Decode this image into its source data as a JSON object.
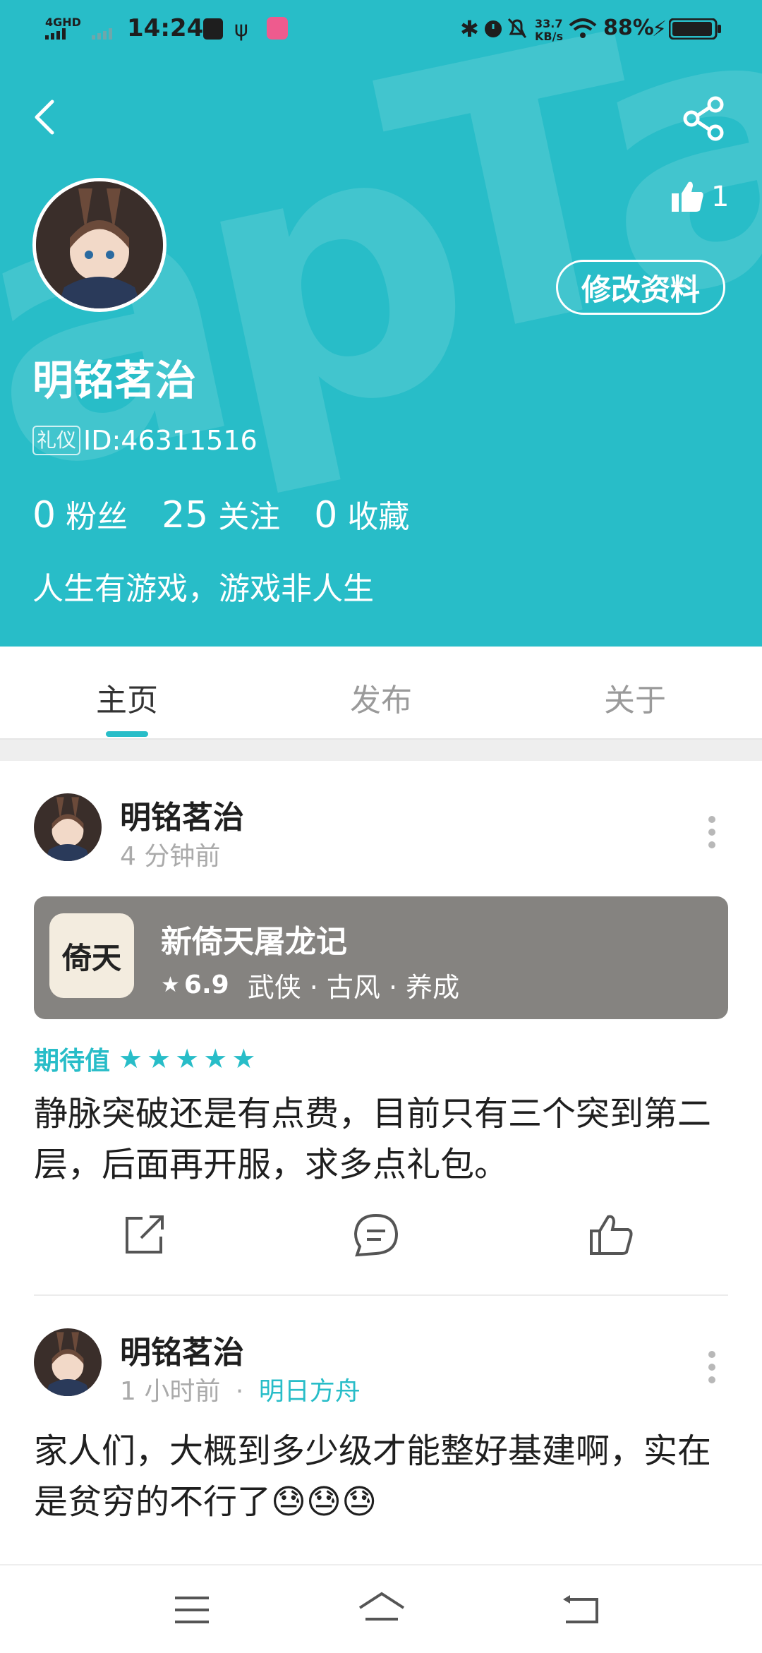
{
  "status_bar": {
    "network": "4GHD",
    "time": "14:24",
    "speed_value": "33.7",
    "speed_unit": "KB/s",
    "battery": "88%"
  },
  "header": {
    "like_count": "1",
    "edit_button": "修改资料",
    "username": "明铭茗治",
    "badge": "礼仪",
    "user_id": "ID:46311516",
    "stats": [
      {
        "num": "0",
        "label": "粉丝"
      },
      {
        "num": "25",
        "label": "关注"
      },
      {
        "num": "0",
        "label": "收藏"
      }
    ],
    "bio": "人生有游戏，游戏非人生",
    "bg_color": "#28bdc8"
  },
  "tabs": [
    {
      "label": "主页"
    },
    {
      "label": "发布"
    },
    {
      "label": "关于"
    }
  ],
  "posts": [
    {
      "author": "明铭茗治",
      "time": "4 分钟前",
      "game": {
        "title": "新倚天屠龙记",
        "rating": "6.9",
        "tags": "武侠 · 古风 · 养成",
        "icon_text": "倚天"
      },
      "expect_label": "期待值",
      "stars": 5,
      "content": "静脉突破还是有点费，目前只有三个突到第二层，后面再开服，求多点礼包。"
    },
    {
      "author": "明铭茗治",
      "time": "1 小时前",
      "separator": "·",
      "game_tag": "明日方舟",
      "content": "家人们，大概到多少级才能整好基建啊，实在是贫穷的不行了",
      "emoji": "😓😓😓"
    }
  ]
}
